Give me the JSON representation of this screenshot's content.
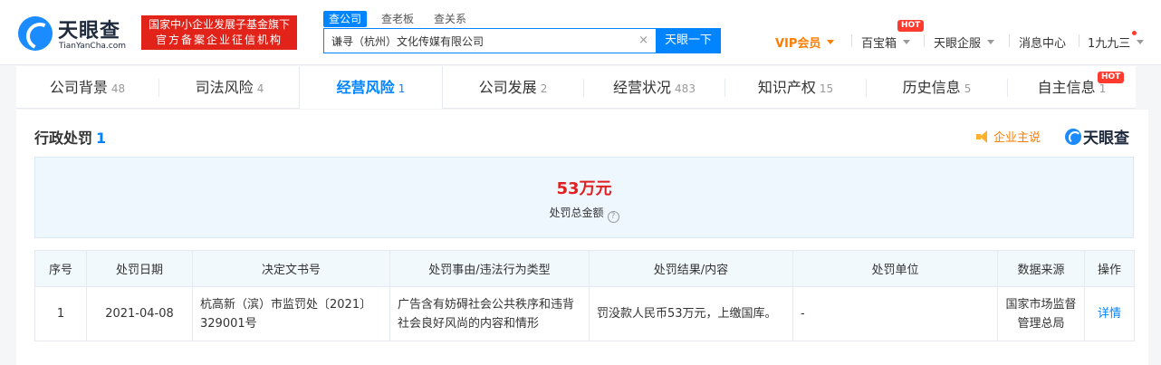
{
  "header": {
    "logo_cn": "天眼查",
    "logo_en": "TianYanCha.com",
    "gov_badge_line1": "国家中小企业发展子基金旗下",
    "gov_badge_line2": "官方备案企业征信机构",
    "search_tabs": [
      "查公司",
      "查老板",
      "查关系"
    ],
    "search_value": "谦寻（杭州）文化传媒有限公司",
    "search_button": "天眼一下",
    "nav": {
      "vip": "VIP会员",
      "treasure": "百宝箱",
      "enterprise": "天眼企服",
      "messages": "消息中心",
      "user": "1九九三"
    },
    "hot_badge": "HOT"
  },
  "tabs": [
    {
      "label": "公司背景",
      "count": "48"
    },
    {
      "label": "司法风险",
      "count": "4"
    },
    {
      "label": "经营风险",
      "count": "1"
    },
    {
      "label": "公司发展",
      "count": "2"
    },
    {
      "label": "经营状况",
      "count": "483"
    },
    {
      "label": "知识产权",
      "count": "15"
    },
    {
      "label": "历史信息",
      "count": "5"
    },
    {
      "label": "自主信息",
      "count": "1"
    }
  ],
  "section": {
    "title": "行政处罚",
    "count": "1",
    "speak_label": "企业主说",
    "mini_logo": "天眼查"
  },
  "summary": {
    "amount": "53万元",
    "label": "处罚总金额"
  },
  "table": {
    "headers": [
      "序号",
      "处罚日期",
      "决定文书号",
      "处罚事由/违法行为类型",
      "处罚结果/内容",
      "处罚单位",
      "数据来源",
      "操作"
    ],
    "rows": [
      {
        "index": "1",
        "date": "2021-04-08",
        "doc_no": "杭高新（滨）市监罚处〔2021〕329001号",
        "reason": "广告含有妨碍社会公共秩序和违背社会良好风尚的内容和情形",
        "result": "罚没款人民币53万元，上缴国库。",
        "unit": "-",
        "source": "国家市场监督管理总局",
        "action": "详情"
      }
    ]
  }
}
